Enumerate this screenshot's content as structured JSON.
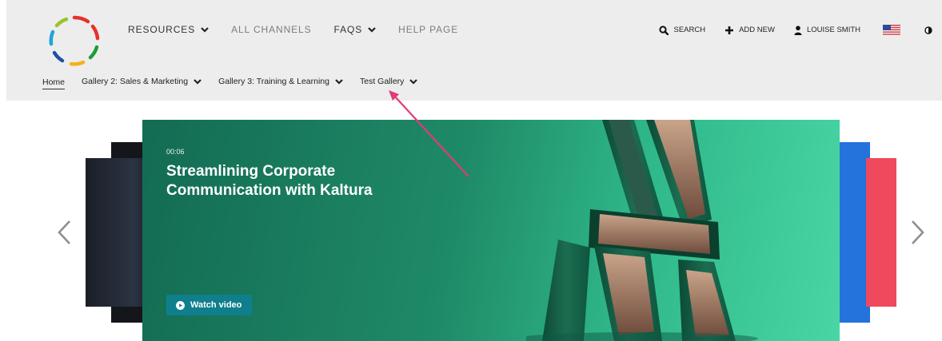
{
  "header": {
    "top_nav": [
      {
        "label": "RESOURCES",
        "has_dropdown": true,
        "muted": false
      },
      {
        "label": "ALL CHANNELS",
        "has_dropdown": false,
        "muted": true
      },
      {
        "label": "FAQS",
        "has_dropdown": true,
        "muted": false
      },
      {
        "label": "HELP PAGE",
        "has_dropdown": false,
        "muted": true
      }
    ],
    "utilities": {
      "search_label": "SEARCH",
      "add_new_label": "ADD NEW",
      "user_label": "LOUISE SMITH"
    },
    "sub_nav": [
      {
        "label": "Home",
        "active": true,
        "has_dropdown": false
      },
      {
        "label": "Gallery 2: Sales & Marketing",
        "has_dropdown": true
      },
      {
        "label": "Gallery 3: Training & Learning",
        "has_dropdown": true
      },
      {
        "label": "Test Gallery",
        "has_dropdown": true
      }
    ]
  },
  "carousel": {
    "featured": {
      "duration": "00:06",
      "title": "Streamlining Corporate Communication with Kaltura",
      "cta_label": "Watch video"
    },
    "prev_icon": "chevron-left-icon",
    "next_icon": "chevron-right-icon"
  },
  "colors": {
    "header_bg": "#ededed",
    "slide_green": "#1f8a67",
    "cta_bg": "#0f7e8d",
    "annotation_arrow": "#e23a7a",
    "side_blue": "#2473dc",
    "side_red": "#f0485d"
  }
}
